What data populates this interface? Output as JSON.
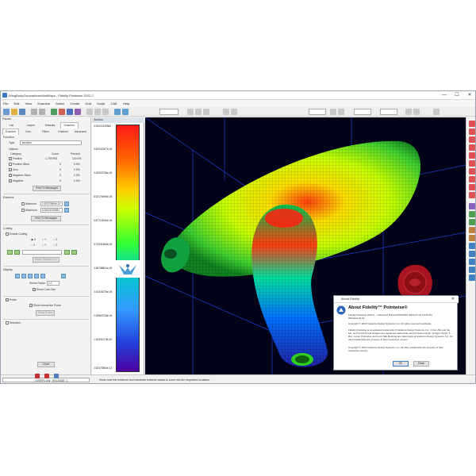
{
  "window": {
    "title": "WingBodyOscarableanWadMaps - Fidelity Pointwise 2022.2",
    "minimize": "—",
    "maximize": "☐",
    "close": "✕"
  },
  "menu": [
    "File",
    "Edit",
    "View",
    "Examine",
    "Select",
    "Create",
    "Grid",
    "Script",
    "CAE",
    "Help"
  ],
  "panels": {
    "header": "Panels",
    "tabs_top": [
      "List",
      "Layers",
      "Defaults",
      "Examine"
    ],
    "tabs_bottom": [
      "Examine",
      "Cuts",
      "Filters",
      "Channel",
      "Advanced"
    ],
    "function": {
      "heading": "Function",
      "type_label": "Type",
      "type_value": "Jacobian",
      "options_label": "Options",
      "columns": [
        "Category",
        "Count",
        "Percent"
      ],
      "rows": [
        {
          "label": "Positive",
          "count": "1 799 993",
          "percent": "100.0%"
        },
        {
          "label": "Positive Skew",
          "count": "0",
          "percent": "0.0%"
        },
        {
          "label": "Zero",
          "count": "0",
          "percent": "0.0%"
        },
        {
          "label": "Negative Skew",
          "count": "0",
          "percent": "0.0%"
        },
        {
          "label": "Negative",
          "count": "0",
          "percent": "0.0%"
        }
      ],
      "print_button": "Print To Messages"
    },
    "extrema": {
      "heading": "Extrema",
      "minimum_label": "Minimum",
      "minimum_value": "2.62370584e-12",
      "maximum_label": "Maximum",
      "maximum_value": "0.00011339384"
    },
    "cutting": {
      "heading": "Cutting",
      "enable_label": "Enable Cutting",
      "axes": [
        "X",
        "Y",
        "Z"
      ],
      "apply_button": "Make Restrict Cut"
    },
    "display": {
      "heading": "Display",
      "shrink_label": "Shrink Factor",
      "shrink_value": "1.0",
      "color_bar_label": "Show Color Bar"
    },
    "probe": {
      "heading": "Probe",
      "interactive_label": "Show Interactive Probe",
      "button": "Show Probe"
    },
    "selection_label": "Selection",
    "close_button": "Close"
  },
  "section": {
    "header": "Section",
    "scale_labels": [
      "0.00011339384",
      "9.82042287e-05",
      "9.26900738e-05",
      "8.02176498e-05",
      "6.87713936e-05",
      "5.73251383e-05",
      "4.58788831e-05",
      "3.44326278e-05",
      "2.29863726e-05",
      "1.15401174e-05",
      "2.62370584e-12"
    ]
  },
  "status": {
    "message": "Hover over the minimum and maximum extreme values to zoom into the respective locations.",
    "overflow": "OVERFLOW",
    "release": "RELEASE: 1"
  },
  "about": {
    "title": "About Fidelity",
    "close": "✕",
    "heading": "About Fidelity™ Pointwise®",
    "version": "Fidelity Pointwise 2022.2 – Optimized Build 2207012045 (2022-07-01 16:25:00)",
    "os": "Windows 64 bit",
    "copyright": "Copyright © 2022 Cadence Design Systems, Inc. All rights reserved worldwide.",
    "trademark1": "Fidelity Pointwise is a registered trademark of Cadence Design Systems, Inc. in the USA and the EU. Get the Point and Gridgen are registered trademarks and Pointwise Glyph, Gridgen Glyph, T-Rex, Lunar, Pointwise, and Let's Talk Meshing are trademarks of Cadence Design Systems, Inc. All other trademarks are property of their respective owners.",
    "trademark2": "Copyright © 2022 Cadence Design Systems, Inc. All other trademarks are property of their respective owners.",
    "ok": "OK",
    "close_button": "Close"
  },
  "colors": {
    "viewport_bg": "#020218",
    "grid_lines": "#1f3fd6",
    "bar_red": "#ff1a1a",
    "bar_violet": "#4b00a0",
    "seal": "#a8141f"
  }
}
